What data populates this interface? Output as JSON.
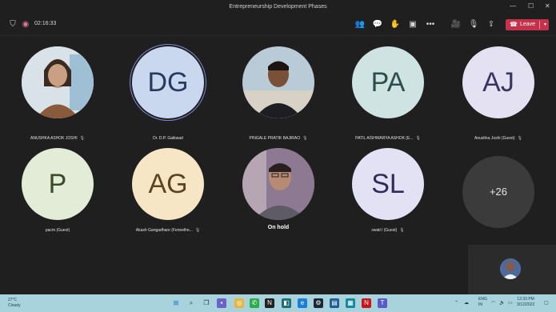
{
  "window": {
    "title": "Entrepreneurship Development Phases",
    "minimize": "—",
    "maximize": "☐",
    "close": "✕"
  },
  "toolbar": {
    "timer": "02:16:33",
    "leave_label": "Leave"
  },
  "participants": [
    {
      "name": "ANUSHKA ASHOK JOSHI",
      "initials": "",
      "avatar_type": "photo",
      "avatar_bg": "#6b6b6b",
      "text_color": "#ffffff"
    },
    {
      "name": "Dr. D.P. Gaikwad",
      "initials": "DG",
      "avatar_type": "initials",
      "avatar_bg": "#c9d7ef",
      "text_color": "#2a3a5c"
    },
    {
      "name": "PINGALE PRATIK BAJIRAO",
      "initials": "",
      "avatar_type": "photo",
      "avatar_bg": "#8aa6b8",
      "text_color": "#ffffff"
    },
    {
      "name": "PATIL AISHWARYA ASHOK (E...",
      "initials": "PA",
      "avatar_type": "initials",
      "avatar_bg": "#cfe4e2",
      "text_color": "#2e4e4d"
    },
    {
      "name": "Anushka Joshi (Guest)",
      "initials": "AJ",
      "avatar_type": "initials",
      "avatar_bg": "#e4e2f2",
      "text_color": "#3a3560"
    },
    {
      "name": "pacm (Guest)",
      "initials": "P",
      "avatar_type": "initials",
      "avatar_bg": "#e3ecd6",
      "text_color": "#3b4a28"
    },
    {
      "name": "Akash Gangadhare (Fennelhe...",
      "initials": "AG",
      "avatar_type": "initials",
      "avatar_bg": "#f7e6c6",
      "text_color": "#5b4520"
    },
    {
      "name": "On hold",
      "initials": "",
      "avatar_type": "photo",
      "avatar_bg": "#7a6a86",
      "text_color": "#ffffff"
    },
    {
      "name": "swati l (Guest)",
      "initials": "SL",
      "avatar_type": "initials",
      "avatar_bg": "#e3e2f4",
      "text_color": "#2f2c5a"
    },
    {
      "name": "",
      "initials": "+26",
      "avatar_type": "overflow",
      "avatar_bg": "#3b3b3b",
      "text_color": "#e6e6e6"
    }
  ],
  "taskbar": {
    "weather_temp": "27°C",
    "weather_desc": "Cloudy",
    "lang": "ENG\nIN",
    "time": "12:33 PM",
    "date": "3/12/2022"
  },
  "colors": {
    "leave": "#c4314b",
    "taskbar": "#a8d2dc",
    "stage": "#1f1f1f"
  }
}
